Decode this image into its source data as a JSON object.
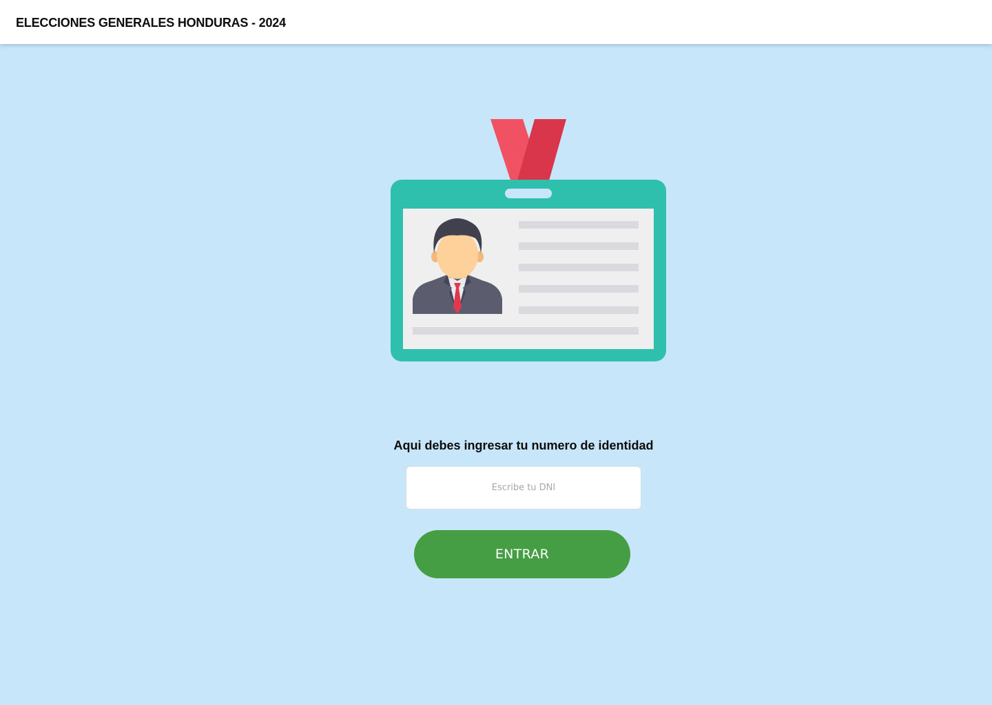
{
  "header": {
    "title": "ELECCIONES GENERALES HONDURAS - 2024"
  },
  "illustration": {
    "icon": "id-card-icon",
    "colors": {
      "card": "#2ec0ad",
      "card_inner": "#efefef",
      "lanyard_light": "#f05263",
      "lanyard_dark": "#d9364c",
      "suit": "#5b5c6d",
      "hair": "#40414c",
      "skin": "#fed19b",
      "tie": "#e0394f",
      "text_lines": "#d9d9de"
    }
  },
  "login": {
    "prompt": "Aqui debes ingresar tu numero de identidad",
    "dni_placeholder": "Escribe tu DNI",
    "dni_value": "",
    "submit_label": "ENTRAR"
  },
  "colors": {
    "background": "#c8e6f9",
    "header_bg": "#ffffff",
    "button_bg": "#469e44",
    "button_text": "#ffffff"
  }
}
